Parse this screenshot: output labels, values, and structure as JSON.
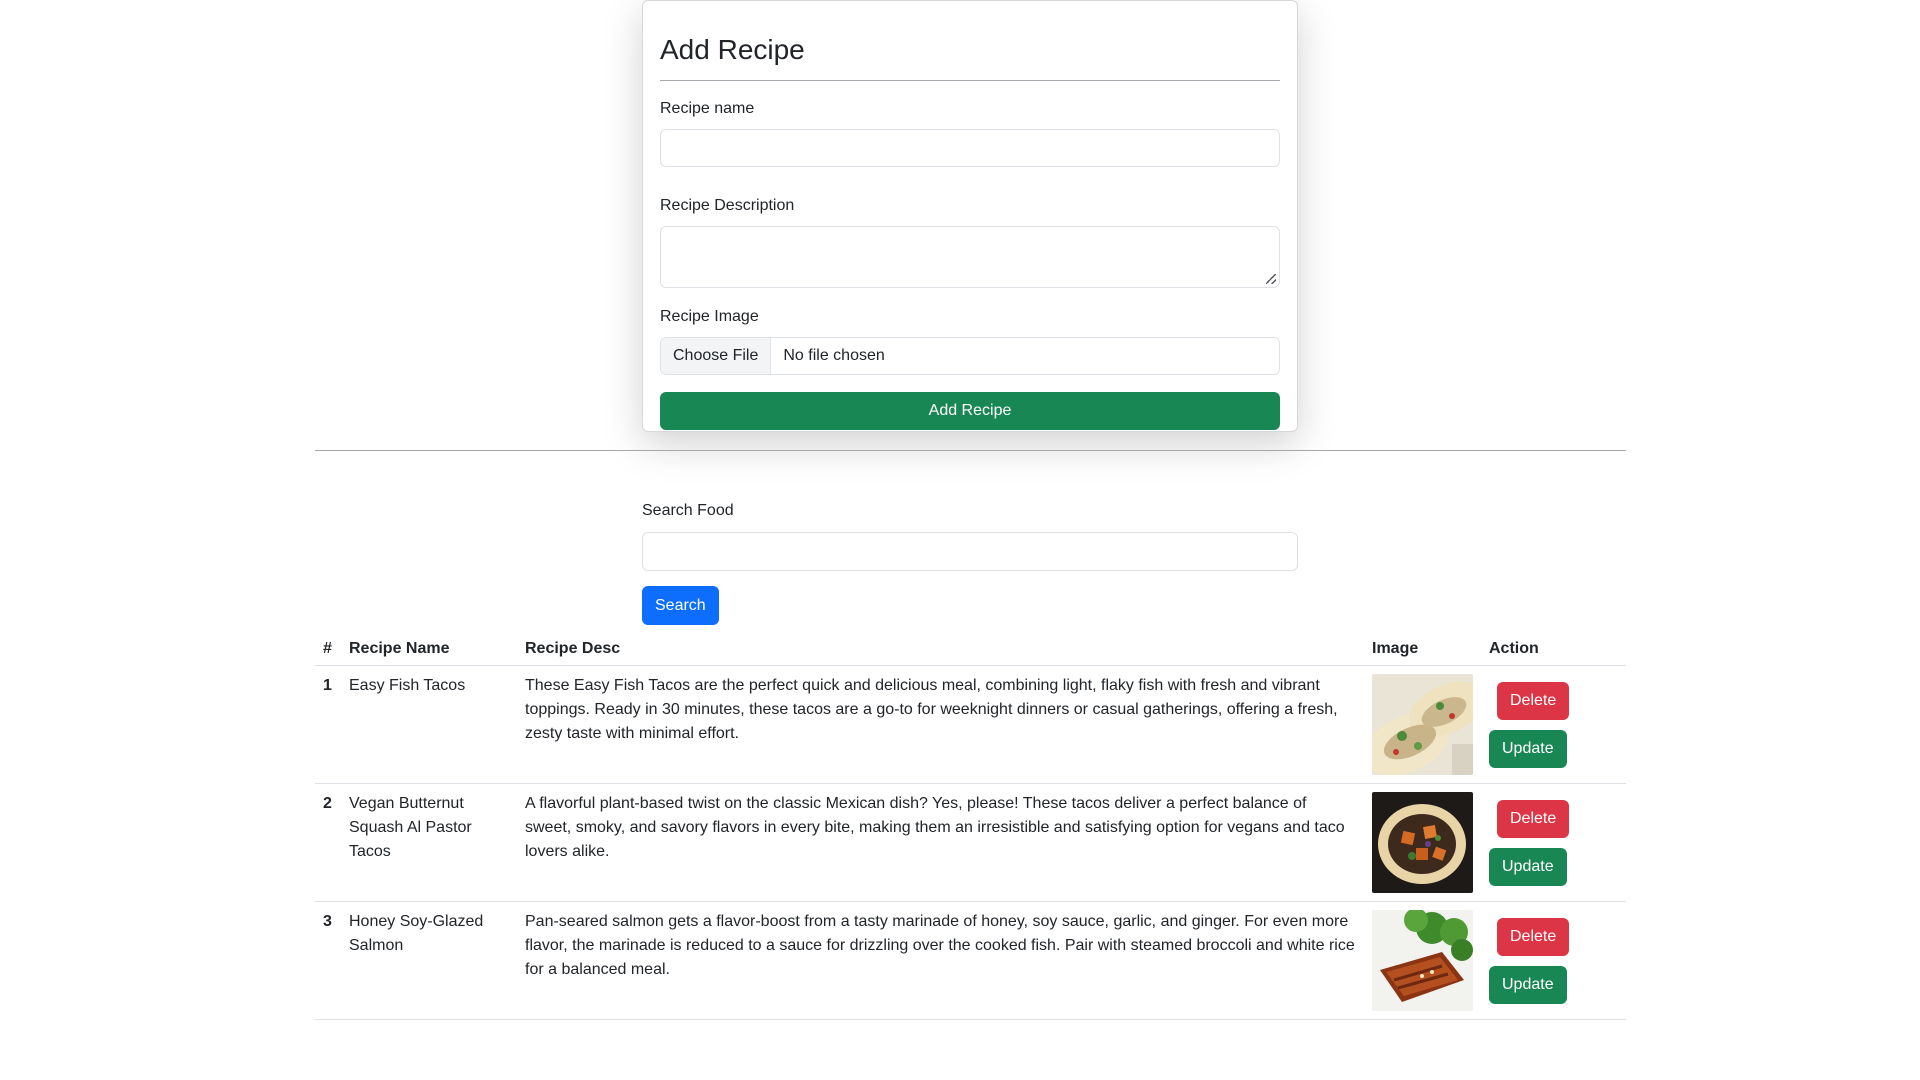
{
  "form": {
    "title": "Add Recipe",
    "name_label": "Recipe name",
    "name_value": "",
    "desc_label": "Recipe Description",
    "desc_value": "",
    "image_label": "Recipe Image",
    "file_button": "Choose File",
    "file_status": "No file chosen",
    "submit_label": "Add Recipe"
  },
  "search": {
    "label": "Search Food",
    "value": "",
    "button": "Search"
  },
  "table": {
    "headers": [
      "#",
      "Recipe Name",
      "Recipe Desc",
      "Image",
      "Action"
    ],
    "rows": [
      {
        "num": "1",
        "name": "Easy Fish Tacos",
        "desc": "These Easy Fish Tacos are the perfect quick and delicious meal, combining light, flaky fish with fresh and vibrant toppings. Ready in 30 minutes, these tacos are a go-to for weeknight dinners or casual gatherings, offering a fresh, zesty taste with minimal effort.",
        "image": "fish-tacos-photo",
        "delete": "Delete",
        "update": "Update"
      },
      {
        "num": "2",
        "name": "Vegan Butternut Squash Al Pastor Tacos",
        "desc": "A flavorful plant-based twist on the classic Mexican dish? Yes, please! These tacos deliver a perfect balance of sweet, smoky, and savory flavors in every bite, making them an irresistible and satisfying option for vegans and taco lovers alike.",
        "image": "squash-tacos-photo",
        "delete": "Delete",
        "update": "Update"
      },
      {
        "num": "3",
        "name": "Honey Soy-Glazed Salmon",
        "desc": "Pan-seared salmon gets a flavor-boost from a tasty marinade of honey, soy sauce, garlic, and ginger. For even more flavor, the marinade is reduced to a sauce for drizzling over the cooked fish. Pair with steamed broccoli and white rice for a balanced meal.",
        "image": "salmon-photo",
        "delete": "Delete",
        "update": "Update"
      }
    ]
  },
  "colors": {
    "primary": "#0d6efd",
    "success": "#198754",
    "danger": "#dc3545"
  }
}
